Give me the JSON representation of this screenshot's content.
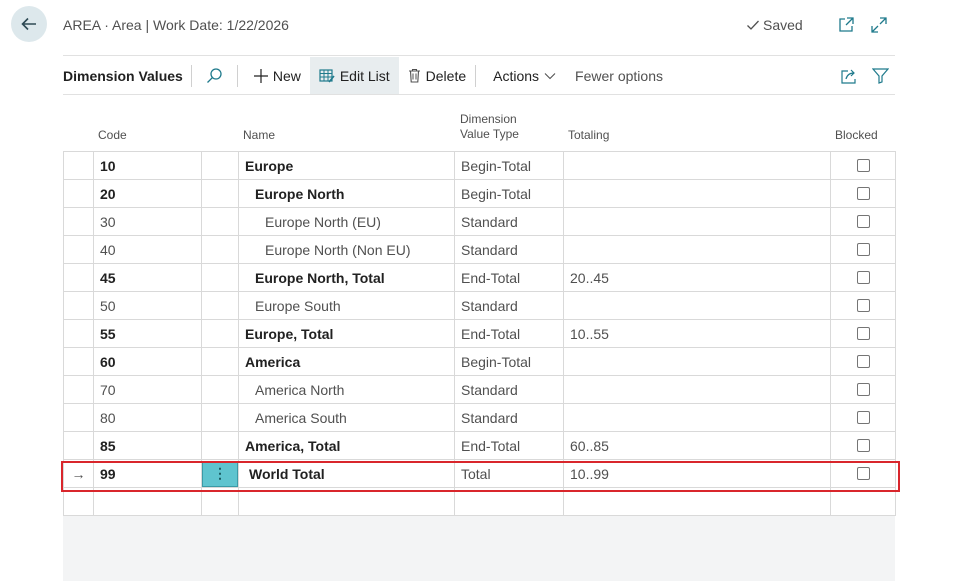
{
  "header": {
    "title": "AREA · Area | Work Date: 1/22/2026",
    "saved_label": "Saved"
  },
  "actionbar": {
    "title": "Dimension Values",
    "new_label": "New",
    "edit_list_label": "Edit List",
    "delete_label": "Delete",
    "actions_label": "Actions",
    "fewer_options_label": "Fewer options"
  },
  "columns": {
    "code": "Code",
    "name": "Name",
    "type_line1": "Dimension",
    "type_line2": "Value Type",
    "totaling": "Totaling",
    "blocked": "Blocked"
  },
  "rows": [
    {
      "code": "10",
      "name": "Europe",
      "indent": 0,
      "type": "Begin-Total",
      "totaling": "",
      "blocked": false,
      "bold": true
    },
    {
      "code": "20",
      "name": "Europe North",
      "indent": 1,
      "type": "Begin-Total",
      "totaling": "",
      "blocked": false,
      "bold": true
    },
    {
      "code": "30",
      "name": "Europe North (EU)",
      "indent": 2,
      "type": "Standard",
      "totaling": "",
      "blocked": false,
      "bold": false
    },
    {
      "code": "40",
      "name": "Europe North (Non EU)",
      "indent": 2,
      "type": "Standard",
      "totaling": "",
      "blocked": false,
      "bold": false
    },
    {
      "code": "45",
      "name": "Europe North, Total",
      "indent": 1,
      "type": "End-Total",
      "totaling": "20..45",
      "blocked": false,
      "bold": true
    },
    {
      "code": "50",
      "name": "Europe South",
      "indent": 1,
      "type": "Standard",
      "totaling": "",
      "blocked": false,
      "bold": false
    },
    {
      "code": "55",
      "name": "Europe, Total",
      "indent": 0,
      "type": "End-Total",
      "totaling": "10..55",
      "blocked": false,
      "bold": true
    },
    {
      "code": "60",
      "name": "America",
      "indent": 0,
      "type": "Begin-Total",
      "totaling": "",
      "blocked": false,
      "bold": true
    },
    {
      "code": "70",
      "name": "America North",
      "indent": 1,
      "type": "Standard",
      "totaling": "",
      "blocked": false,
      "bold": false
    },
    {
      "code": "80",
      "name": "America South",
      "indent": 1,
      "type": "Standard",
      "totaling": "",
      "blocked": false,
      "bold": false
    },
    {
      "code": "85",
      "name": "America, Total",
      "indent": 0,
      "type": "End-Total",
      "totaling": "60..85",
      "blocked": false,
      "bold": true
    },
    {
      "code": "99",
      "name": "World Total",
      "indent": 0,
      "type": "Total",
      "totaling": "10..99",
      "blocked": false,
      "bold": true,
      "selected": true
    }
  ],
  "icons": {
    "back": "back-arrow-icon",
    "saved": "checkmark-icon",
    "open_new": "open-in-new-window-icon",
    "expand": "expand-icon",
    "search": "search-icon",
    "share": "share-icon",
    "filter": "filter-icon",
    "row_indicator": "→",
    "row_menu": "⋮"
  },
  "colors": {
    "accent": "#5fc4cf",
    "highlight_border": "#d9262c"
  }
}
